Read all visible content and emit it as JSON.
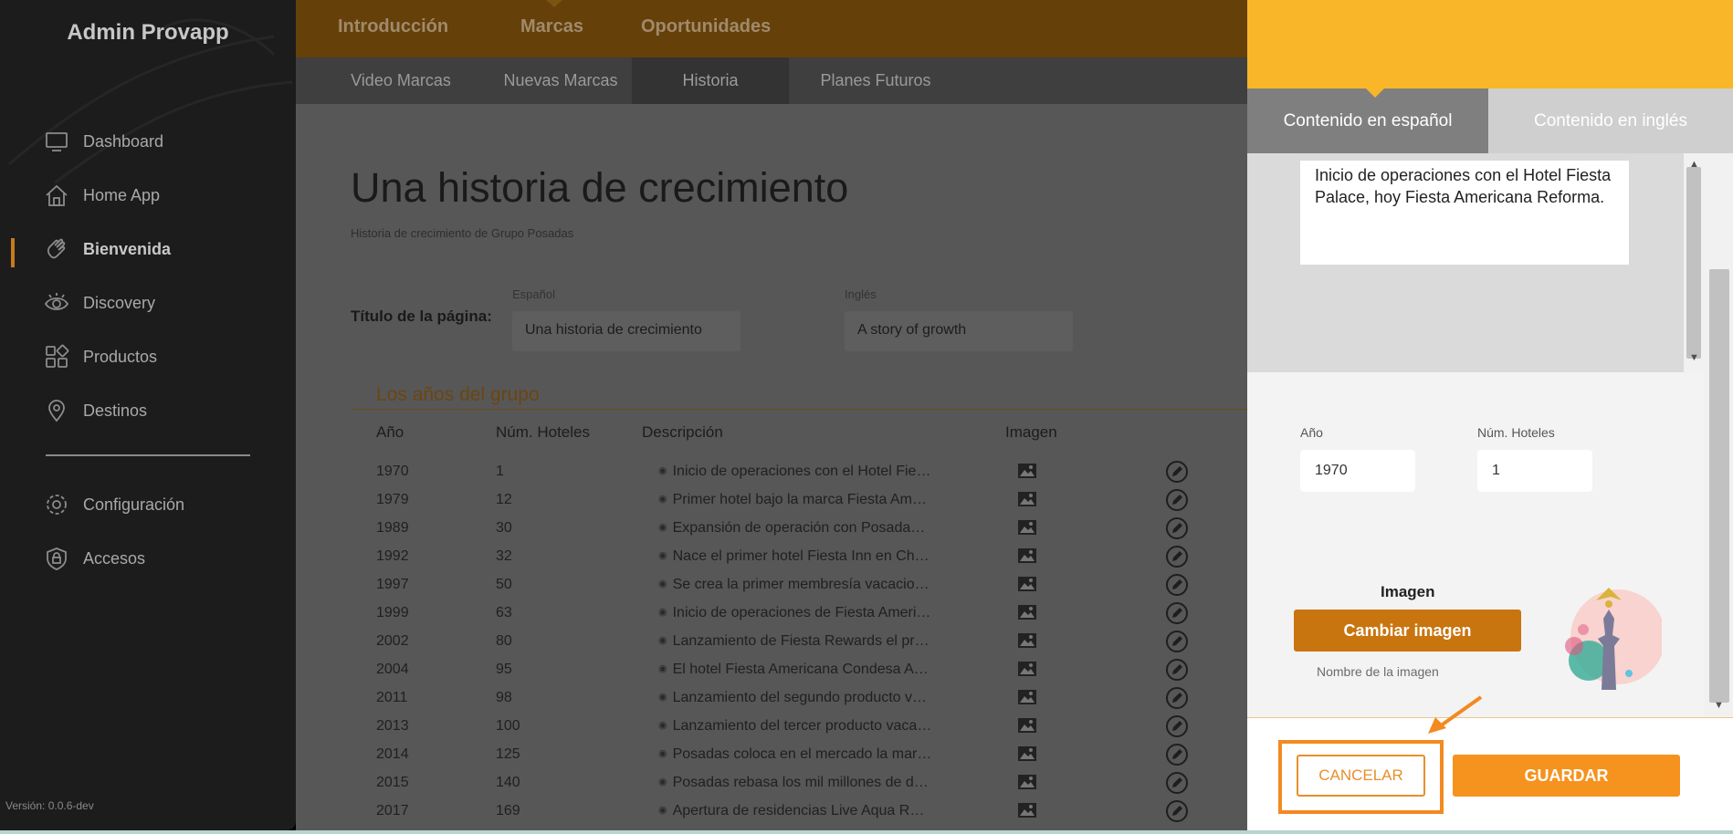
{
  "sidebar": {
    "brand": "Admin Provapp",
    "items": [
      {
        "label": "Dashboard",
        "icon": "monitor-icon"
      },
      {
        "label": "Home App",
        "icon": "home-icon"
      },
      {
        "label": "Bienvenida",
        "icon": "wave-hand-icon"
      },
      {
        "label": "Discovery",
        "icon": "eye-icon"
      },
      {
        "label": "Productos",
        "icon": "grid-icon"
      },
      {
        "label": "Destinos",
        "icon": "location-pin-icon"
      },
      {
        "label": "Configuración",
        "icon": "gear-icon"
      },
      {
        "label": "Accesos",
        "icon": "shield-icon"
      }
    ],
    "version": "Versión: 0.0.6-dev"
  },
  "topnav": {
    "tabs": [
      "Introducción",
      "Marcas",
      "Oportunidades"
    ]
  },
  "subnav": {
    "tabs": [
      "Video Marcas",
      "Nuevas Marcas",
      "Historia",
      "Planes Futuros"
    ]
  },
  "page": {
    "title": "Una historia de crecimiento",
    "subtitle": "Historia de crecimiento de Grupo Posadas",
    "title_field_label": "Título de la página:",
    "es_label": "Español",
    "es_value": "Una historia de crecimiento",
    "en_label": "Inglés",
    "en_value": "A story of growth",
    "section_title": "Los años del grupo"
  },
  "table": {
    "headers": [
      "Año",
      "Núm. Hoteles",
      "Descripción",
      "Imagen"
    ],
    "rows": [
      {
        "year": "1970",
        "hotels": "1",
        "desc": "Inicio de operaciones con el Hotel Fiesta Palace"
      },
      {
        "year": "1979",
        "hotels": "12",
        "desc": "Primer hotel bajo la marca Fiesta Americana"
      },
      {
        "year": "1989",
        "hotels": "30",
        "desc": "Expansión de operación con Posadas de México"
      },
      {
        "year": "1992",
        "hotels": "32",
        "desc": "Nace el primer hotel Fiesta Inn en Chihuahua"
      },
      {
        "year": "1997",
        "hotels": "50",
        "desc": "Se crea la primer membresía vacacional"
      },
      {
        "year": "1999",
        "hotels": "63",
        "desc": "Inicio de operaciones de Fiesta Americana Grand"
      },
      {
        "year": "2002",
        "hotels": "80",
        "desc": "Lanzamiento de Fiesta Rewards el primer programa"
      },
      {
        "year": "2004",
        "hotels": "95",
        "desc": "El hotel Fiesta Americana Condesa Acapulco"
      },
      {
        "year": "2011",
        "hotels": "98",
        "desc": "Lanzamiento del segundo producto vacacional"
      },
      {
        "year": "2013",
        "hotels": "100",
        "desc": "Lanzamiento del tercer producto vacacional"
      },
      {
        "year": "2014",
        "hotels": "125",
        "desc": "Posadas coloca en el mercado la marca"
      },
      {
        "year": "2015",
        "hotels": "140",
        "desc": "Posadas rebasa los mil millones de dólares"
      },
      {
        "year": "2017",
        "hotels": "169",
        "desc": "Apertura de residencias Live Aqua Residence"
      }
    ]
  },
  "panel": {
    "tab_es": "Contenido en español",
    "tab_en": "Contenido en inglés",
    "description": "Inicio de operaciones con el Hotel Fiesta Palace, hoy Fiesta Americana Reforma.",
    "year_label": "Año",
    "year_value": "1970",
    "hotels_label": "Núm. Hoteles",
    "hotels_value": "1",
    "image_label": "Imagen",
    "change_image": "Cambiar imagen",
    "image_name_label": "Nombre de la imagen",
    "cancel": "CANCELAR",
    "save": "GUARDAR"
  },
  "colors": {
    "accent": "#f6921e",
    "panel_header": "#f8b628",
    "highlight": "#f28a21"
  }
}
